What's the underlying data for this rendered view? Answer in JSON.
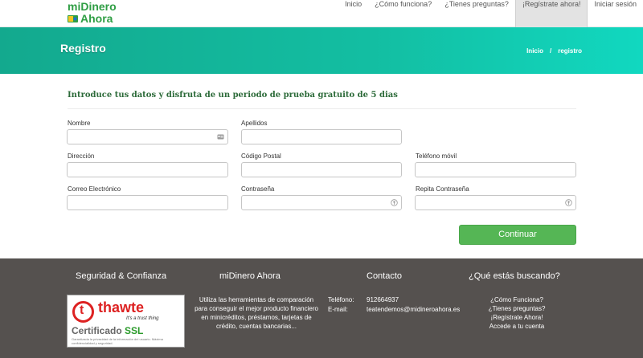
{
  "header": {
    "logo_line1": "miDinero",
    "logo_line2": "Ahora",
    "nav": [
      "Inicio",
      "¿Cómo funciona?",
      "¿Tienes preguntas?",
      "¡Regístrate ahora!",
      "Iniciar sesión"
    ],
    "active_index": 3
  },
  "banner": {
    "title": "Registro",
    "breadcrumb": [
      "Inicio",
      "/",
      "registro"
    ]
  },
  "form": {
    "intro": "Introduce tus datos y disfruta de un periodo de prueba gratuito de 5 dias",
    "fields": {
      "nombre": {
        "label": "Nombre",
        "value": ""
      },
      "apellidos": {
        "label": "Apellidos",
        "value": ""
      },
      "direccion": {
        "label": "Dirección",
        "value": ""
      },
      "codigo_postal": {
        "label": "Código Postal",
        "value": ""
      },
      "telefono_movil": {
        "label": "Teléfono móvil",
        "value": ""
      },
      "correo": {
        "label": "Correo Electrónico",
        "value": ""
      },
      "contrasena": {
        "label": "Contraseña",
        "value": ""
      },
      "repita_contrasena": {
        "label": "Repita Contraseña",
        "value": ""
      }
    },
    "submit_label": "Continuar"
  },
  "footer": {
    "seguridad": {
      "title": "Seguridad & Confianza",
      "badge_brand": "thawte",
      "badge_slogan": "It's a trust thing",
      "badge_cert": "Certificado",
      "badge_ssl": "SSL",
      "badge_small": "Garantizada la privacidad de la información del usuario. Máxima confidencialidad y seguridad."
    },
    "about": {
      "title": "miDinero Ahora",
      "text": "Utiliza las herramientas de comparación para conseguir el mejor producto financiero en minicréditos, préstamos, tarjetas de crédito, cuentas bancarias..."
    },
    "contacto": {
      "title": "Contacto",
      "phone_label": "Teléfono:",
      "phone": "912664937",
      "email_label": "E-mail:",
      "email": "teatendemos@midineroahora.es"
    },
    "buscando": {
      "title": "¿Qué estás buscando?",
      "links": [
        "¿Cómo Funciona?",
        "¿Tienes preguntas?",
        "¡Regístrate Ahora!",
        "Accede a tu cuenta"
      ]
    }
  }
}
